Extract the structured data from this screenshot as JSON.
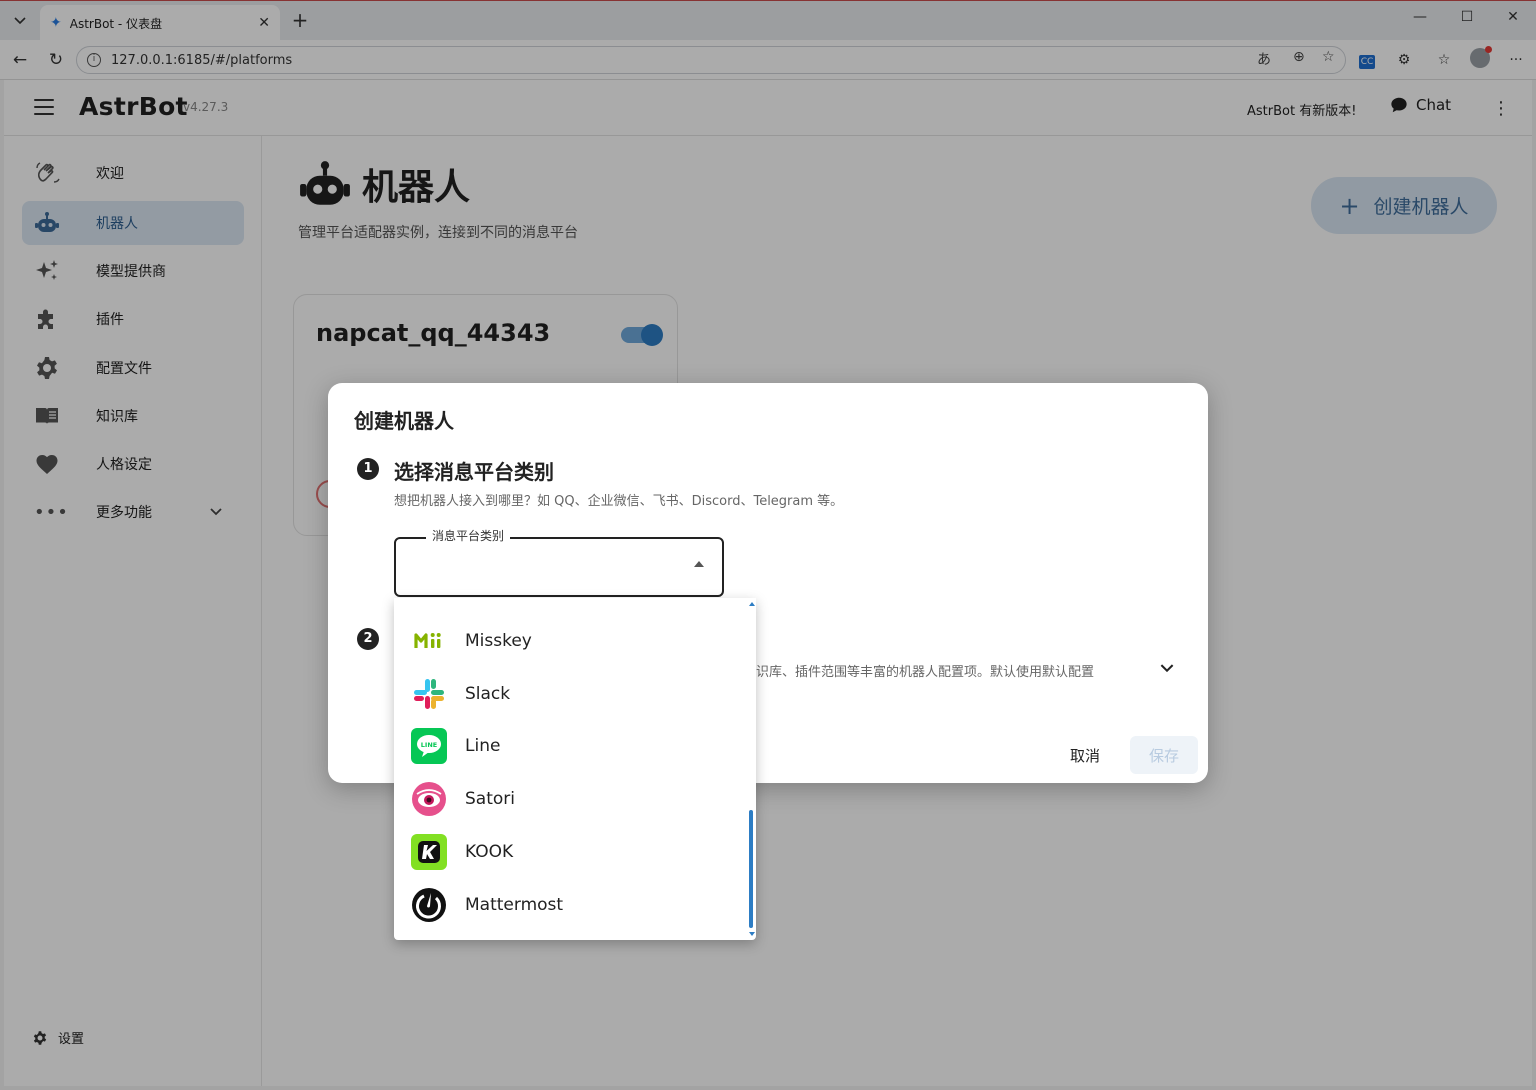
{
  "browser": {
    "tab_title": "AstrBot - 仪表盘",
    "url": "127.0.0.1:6185/#/platforms"
  },
  "appbar": {
    "brand": "AstrBot",
    "version": "v4.27.3",
    "update_notice": "AstrBot 有新版本!",
    "chat_label": "Chat"
  },
  "sidebar": {
    "items": [
      {
        "label": "欢迎",
        "icon": "wave-hand-icon"
      },
      {
        "label": "机器人",
        "icon": "robot-icon",
        "active": true
      },
      {
        "label": "模型提供商",
        "icon": "sparkle-icon"
      },
      {
        "label": "插件",
        "icon": "puzzle-icon"
      },
      {
        "label": "配置文件",
        "icon": "gear-icon"
      },
      {
        "label": "知识库",
        "icon": "book-icon"
      },
      {
        "label": "人格设定",
        "icon": "heart-icon"
      },
      {
        "label": "更多功能",
        "icon": "dots-icon"
      }
    ],
    "settings_label": "设置"
  },
  "page": {
    "title": "机器人",
    "subtitle": "管理平台适配器实例，连接到不同的消息平台",
    "create_button": "创建机器人",
    "bot_card": {
      "name": "napcat_qq_44343",
      "enabled": true
    }
  },
  "dialog": {
    "title": "创建机器人",
    "step1": {
      "number": "1",
      "title": "选择消息平台类别",
      "description": "想把机器人接入到哪里？如 QQ、企业微信、飞书、Discord、Telegram 等。",
      "field_label": "消息平台类别",
      "field_value": ""
    },
    "step2": {
      "number": "2",
      "description_visible": "识库、插件范围等丰富的机器人配置项。默认使用默认配置"
    },
    "cancel_label": "取消",
    "save_label": "保存"
  },
  "dropdown": {
    "options": [
      {
        "label": "Misskey",
        "logo": "misskey-logo"
      },
      {
        "label": "Slack",
        "logo": "slack-logo"
      },
      {
        "label": "Line",
        "logo": "line-logo"
      },
      {
        "label": "Satori",
        "logo": "satori-logo"
      },
      {
        "label": "KOOK",
        "logo": "kook-logo"
      },
      {
        "label": "Mattermost",
        "logo": "mattermost-logo"
      }
    ]
  },
  "colors": {
    "accent": "#2d7dc4",
    "active_nav_bg": "#dbe7f4",
    "create_btn_bg": "#d9e6f3",
    "line_green": "#06c755",
    "kook_green": "#82e023"
  }
}
